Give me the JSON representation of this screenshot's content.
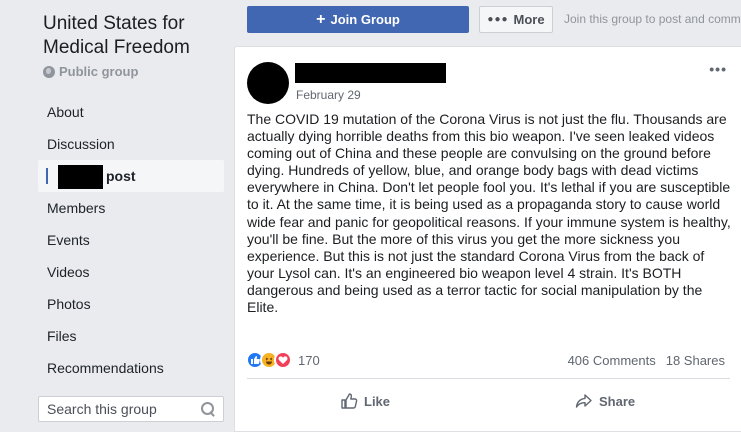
{
  "sidebar": {
    "group_name": "United States for Medical Freedom",
    "privacy": "Public group",
    "nav": [
      {
        "label": "About"
      },
      {
        "label": "Discussion"
      },
      {
        "label": "post"
      },
      {
        "label": "Members"
      },
      {
        "label": "Events"
      },
      {
        "label": "Videos"
      },
      {
        "label": "Photos"
      },
      {
        "label": "Files"
      },
      {
        "label": "Recommendations"
      }
    ],
    "search_placeholder": "Search this group"
  },
  "topbar": {
    "join_label": "Join Group",
    "more_label": "More",
    "join_hint": "Join this group to post and comment."
  },
  "post": {
    "date": "February 29",
    "body": "The COVID 19 mutation of the Corona Virus is not just the flu. Thousands are actually dying horrible deaths from this bio weapon. I've seen leaked videos coming out of China and these people are convulsing on the ground before dying. Hundreds of yellow, blue, and orange body bags with dead victims everywhere in China. Don't let people fool you. It's lethal if you are susceptible to it. At the same time, it is being used as a propaganda story to cause world wide fear and panic for geopolitical reasons. If your immune system is healthy, you'll be fine. But the more of this virus you get the more sickness you experience. But this is not just the standard Corona Virus from the back of your Lysol can. It's an engineered bio weapon level 4 strain. It's BOTH dangerous and being used as a terror tactic for social manipulation by the Elite.",
    "reaction_count": "170",
    "comments": "406 Comments",
    "shares": "18 Shares",
    "like_label": "Like",
    "share_label": "Share"
  },
  "colors": {
    "brand": "#4267b2",
    "background": "#e9ebee",
    "like_reaction": "#2078f4",
    "love_reaction": "#f33e58",
    "haha_reaction": "#f7b125"
  },
  "icons": [
    "globe-icon",
    "plus-icon",
    "more-dots-icon",
    "search-icon",
    "like-reaction-icon",
    "haha-reaction-icon",
    "love-reaction-icon",
    "thumbs-up-icon",
    "share-arrow-icon",
    "post-options-icon"
  ]
}
